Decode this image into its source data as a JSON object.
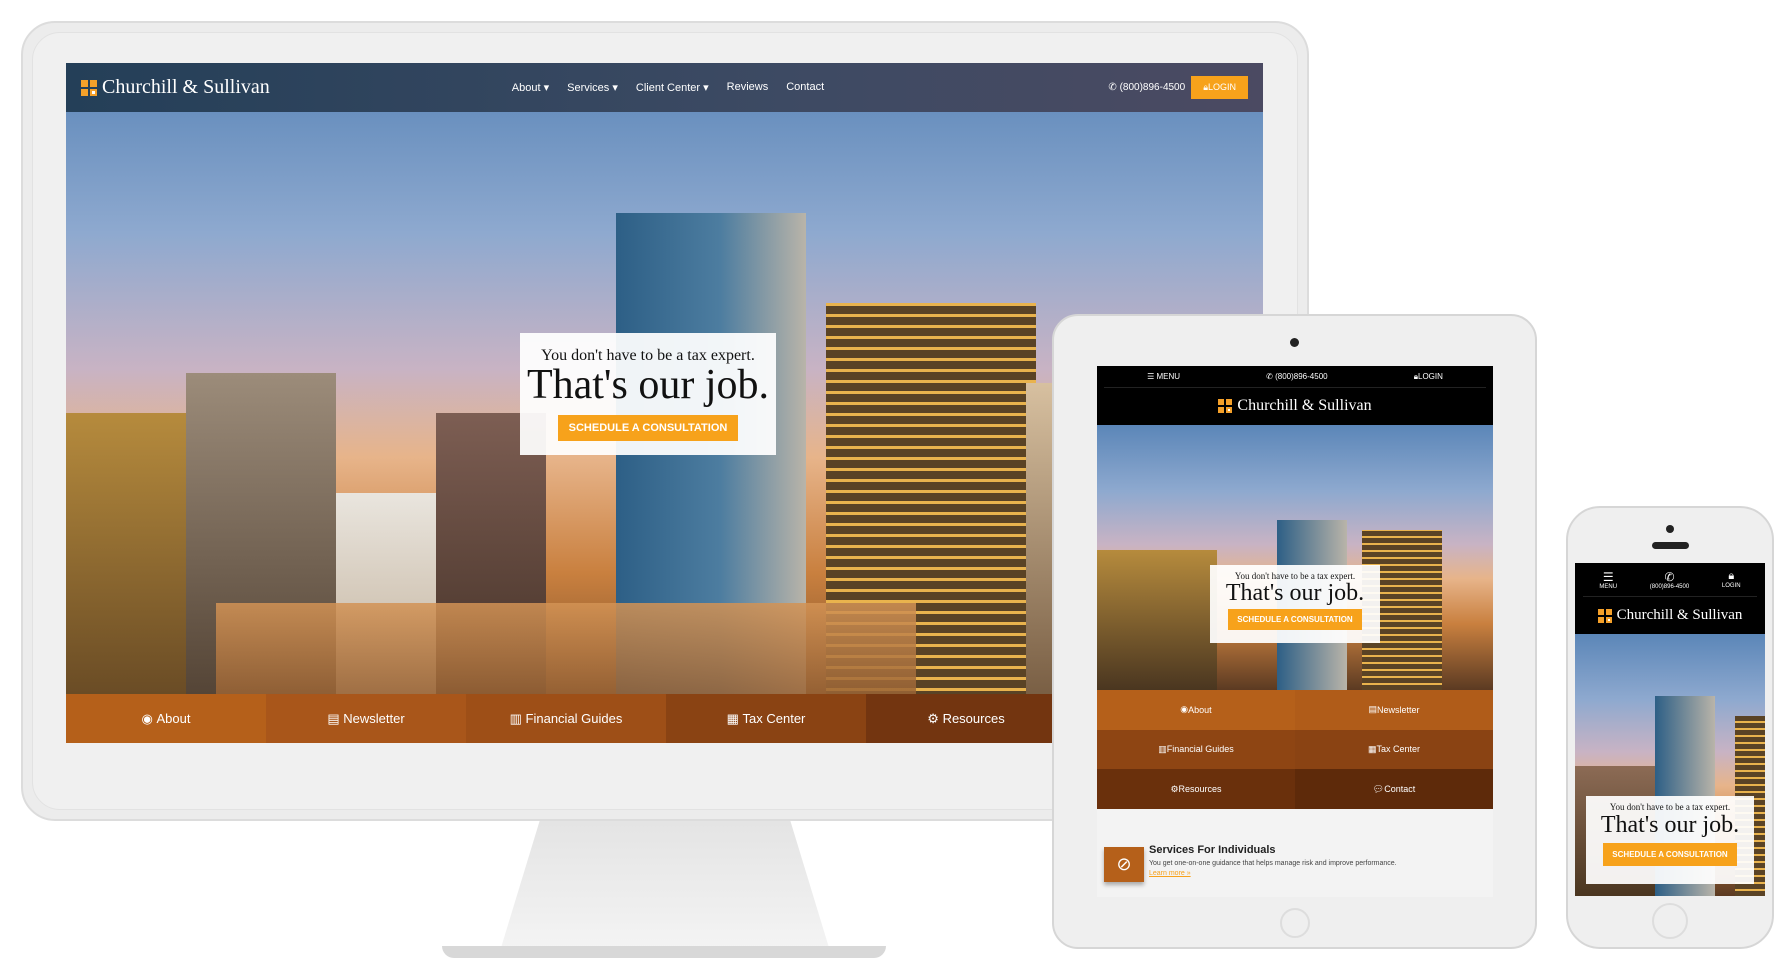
{
  "brand": {
    "name": "Churchill & Sullivan",
    "accent": "#f7a21b",
    "nav_brown": "#b5601a"
  },
  "desktop": {
    "menu": [
      {
        "label": "About",
        "dropdown": true
      },
      {
        "label": "Services",
        "dropdown": true
      },
      {
        "label": "Client Center",
        "dropdown": true
      },
      {
        "label": "Reviews"
      },
      {
        "label": "Contact"
      }
    ],
    "phone": "(800)896-4500",
    "login": "LOGIN",
    "hero": {
      "tagline": "You don't have to be a tax expert.",
      "headline": "That's our job.",
      "cta": "SCHEDULE A CONSULTATION"
    },
    "bottom_nav": [
      {
        "label": "About",
        "icon": "user-circle-icon"
      },
      {
        "label": "Newsletter",
        "icon": "newspaper-icon"
      },
      {
        "label": "Financial Guides",
        "icon": "bar-chart-icon"
      },
      {
        "label": "Tax Center",
        "icon": "calendar-icon"
      },
      {
        "label": "Resources",
        "icon": "gear-icon"
      }
    ]
  },
  "tablet": {
    "menu": "MENU",
    "phone": "(800)896-4500",
    "login": "LOGIN",
    "nav": [
      {
        "label": "About"
      },
      {
        "label": "Newsletter"
      },
      {
        "label": "Financial Guides"
      },
      {
        "label": "Tax Center"
      },
      {
        "label": "Resources"
      },
      {
        "label": "Contact"
      }
    ],
    "service": {
      "title": "Services For Individuals",
      "text": "You get one-on-one guidance that helps manage risk and improve performance.",
      "link": "Learn more »",
      "icon": "compass-icon"
    }
  },
  "phone": {
    "menu": "MENU",
    "phone": "(800)896-4500",
    "login": "LOGIN"
  }
}
